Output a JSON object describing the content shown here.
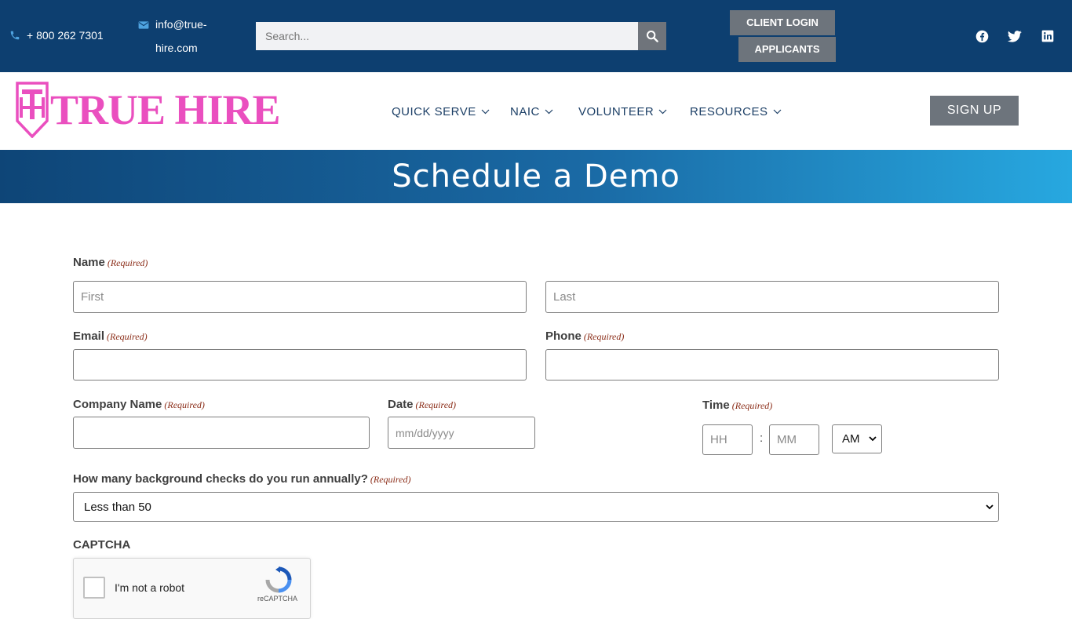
{
  "topbar": {
    "phone": "+ 800 262 7301",
    "email": "info@true-hire.com",
    "search_placeholder": "Search...",
    "client_login": "CLIENT LOGIN",
    "applicants": "APPLICANTS"
  },
  "header": {
    "logo_text": "TRUE HIRE",
    "nav": [
      "QUICK SERVE",
      "NAIC",
      "VOLUNTEER",
      "RESOURCES"
    ],
    "signup": "SIGN UP"
  },
  "banner": {
    "title": "Schedule a Demo"
  },
  "form": {
    "required": "(Required)",
    "name_label": "Name",
    "first_placeholder": "First",
    "last_placeholder": "Last",
    "email_label": "Email",
    "phone_label": "Phone",
    "company_label": "Company Name",
    "date_label": "Date",
    "date_placeholder": "mm/dd/yyyy",
    "time_label": "Time",
    "hh_placeholder": "HH",
    "mm_placeholder": "MM",
    "time_colon": ":",
    "ampm": "AM",
    "checks_label": "How many background checks do you run annually?",
    "checks_value": "Less than 50",
    "captcha_label": "CAPTCHA",
    "captcha_text": "I'm not a robot",
    "recaptcha_brand": "reCAPTCHA"
  },
  "colors": {
    "topbar": "#0d3f70",
    "logo": "#ea4fbf",
    "button": "#6d747c",
    "required": "#8a2b16"
  }
}
